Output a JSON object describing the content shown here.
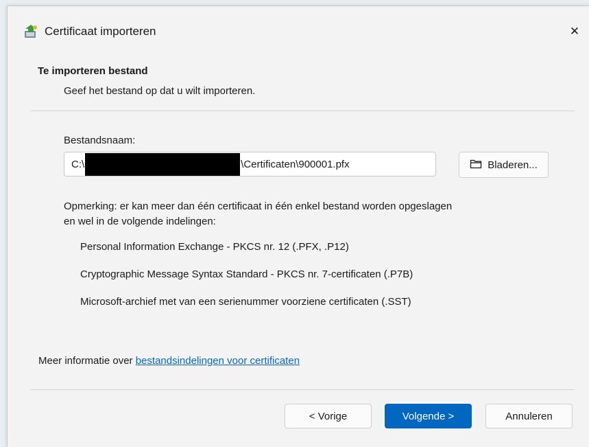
{
  "window": {
    "title": "Certificaat importeren",
    "close_glyph": "✕",
    "icon": "certificate-import-icon"
  },
  "header": {
    "section_title": "Te importeren bestand",
    "section_description": "Geef het bestand op dat u wilt importeren."
  },
  "file": {
    "label": "Bestandsnaam:",
    "value_prefix": "C:\\",
    "value_suffix": "\\Certificaten\\900001.pfx",
    "browse_label": "Bladeren...",
    "browse_icon": "folder-icon"
  },
  "note": {
    "text_line1": "Opmerking: er kan meer dan één certificaat in één enkel bestand worden opgeslagen",
    "text_line2": "en wel in de volgende indelingen:",
    "formats": [
      "Personal Information Exchange - PKCS nr. 12 (.PFX, .P12)",
      "Cryptographic Message Syntax Standard - PKCS nr. 7-certificaten (.P7B)",
      "Microsoft-archief met van een serienummer voorziene certificaten (.SST)"
    ]
  },
  "more_info": {
    "prefix": "Meer informatie over ",
    "link_text": "bestandsindelingen voor certificaten"
  },
  "buttons": {
    "back": "< Vorige",
    "next": "Volgende >",
    "cancel": "Annuleren"
  },
  "colors": {
    "accent": "#0067c0",
    "link": "#0a66c2",
    "dialog_bg": "#f3f3f3"
  }
}
